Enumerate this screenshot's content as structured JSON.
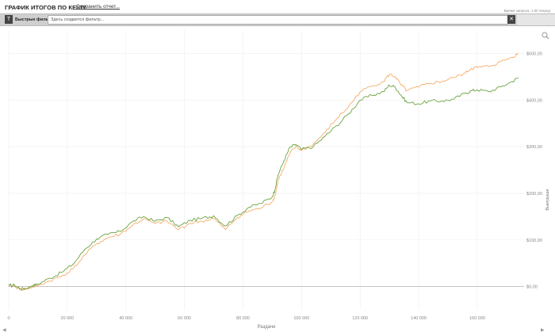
{
  "header": {
    "title": "ГРАФИК ИТОГОВ ПО КЕШУ",
    "save_report": "Сохранить отчет...",
    "query_time": "Время запроса: 1.00 секунд"
  },
  "filters": {
    "button_icon": "filter-icon",
    "label": "Быстрые фильтры",
    "placeholder": "Здесь создается фильтр...",
    "clear_icon": "close-icon"
  },
  "chart_data": {
    "type": "line",
    "xlabel": "Раздачи",
    "ylabel": "Выигрыши",
    "xlim": [
      0,
      176000
    ],
    "ylim": [
      -50,
      550
    ],
    "x_ticks": [
      0,
      20000,
      40000,
      60000,
      80000,
      100000,
      120000,
      140000,
      160000
    ],
    "x_tick_labels": [
      "0",
      "20 000",
      "40 000",
      "60 000",
      "80 000",
      "100 000",
      "120 000",
      "140 000",
      "160 000"
    ],
    "y_ticks": [
      0,
      100,
      200,
      300,
      400,
      500
    ],
    "y_tick_labels": [
      "$0,00",
      "$100,00",
      "$200,00",
      "$300,00",
      "$400,00",
      "$500,00"
    ],
    "grid": true,
    "series": [
      {
        "color": "#5a9a2a",
        "x": [
          0,
          2000,
          4000,
          6000,
          8000,
          10000,
          14000,
          18000,
          22000,
          26000,
          30000,
          34000,
          38000,
          42000,
          46000,
          50000,
          54000,
          58000,
          62000,
          66000,
          70000,
          74000,
          78000,
          82000,
          86000,
          90000,
          91000,
          92000,
          94000,
          96000,
          98000,
          100000,
          104000,
          108000,
          112000,
          116000,
          120000,
          124000,
          128000,
          130000,
          132000,
          134000,
          136000,
          140000,
          144000,
          148000,
          152000,
          156000,
          158000,
          160000,
          164000,
          168000,
          172000,
          174000
        ],
        "values": [
          2,
          3,
          -5,
          -4,
          2,
          5,
          18,
          30,
          48,
          80,
          102,
          112,
          118,
          138,
          150,
          140,
          148,
          128,
          142,
          146,
          152,
          130,
          152,
          170,
          178,
          192,
          210,
          240,
          270,
          298,
          305,
          294,
          300,
          322,
          345,
          370,
          400,
          410,
          418,
          432,
          428,
          410,
          395,
          392,
          398,
          398,
          402,
          415,
          420,
          422,
          418,
          428,
          440,
          448
        ]
      },
      {
        "color": "#f5a35a",
        "x": [
          0,
          2000,
          4000,
          6000,
          8000,
          10000,
          14000,
          18000,
          22000,
          26000,
          30000,
          34000,
          38000,
          42000,
          46000,
          50000,
          54000,
          58000,
          62000,
          66000,
          70000,
          74000,
          78000,
          82000,
          86000,
          90000,
          91000,
          92000,
          94000,
          96000,
          98000,
          100000,
          104000,
          108000,
          112000,
          116000,
          120000,
          124000,
          128000,
          130000,
          132000,
          134000,
          136000,
          140000,
          144000,
          148000,
          152000,
          156000,
          158000,
          160000,
          164000,
          168000,
          172000,
          174000
        ],
        "values": [
          0,
          1,
          -6,
          -5,
          -1,
          2,
          12,
          22,
          38,
          68,
          92,
          105,
          112,
          130,
          145,
          135,
          140,
          122,
          136,
          140,
          146,
          122,
          148,
          162,
          168,
          182,
          196,
          228,
          255,
          285,
          300,
          292,
          305,
          330,
          360,
          385,
          418,
          430,
          440,
          455,
          450,
          432,
          420,
          428,
          436,
          440,
          448,
          458,
          468,
          470,
          472,
          482,
          492,
          500
        ]
      }
    ]
  }
}
